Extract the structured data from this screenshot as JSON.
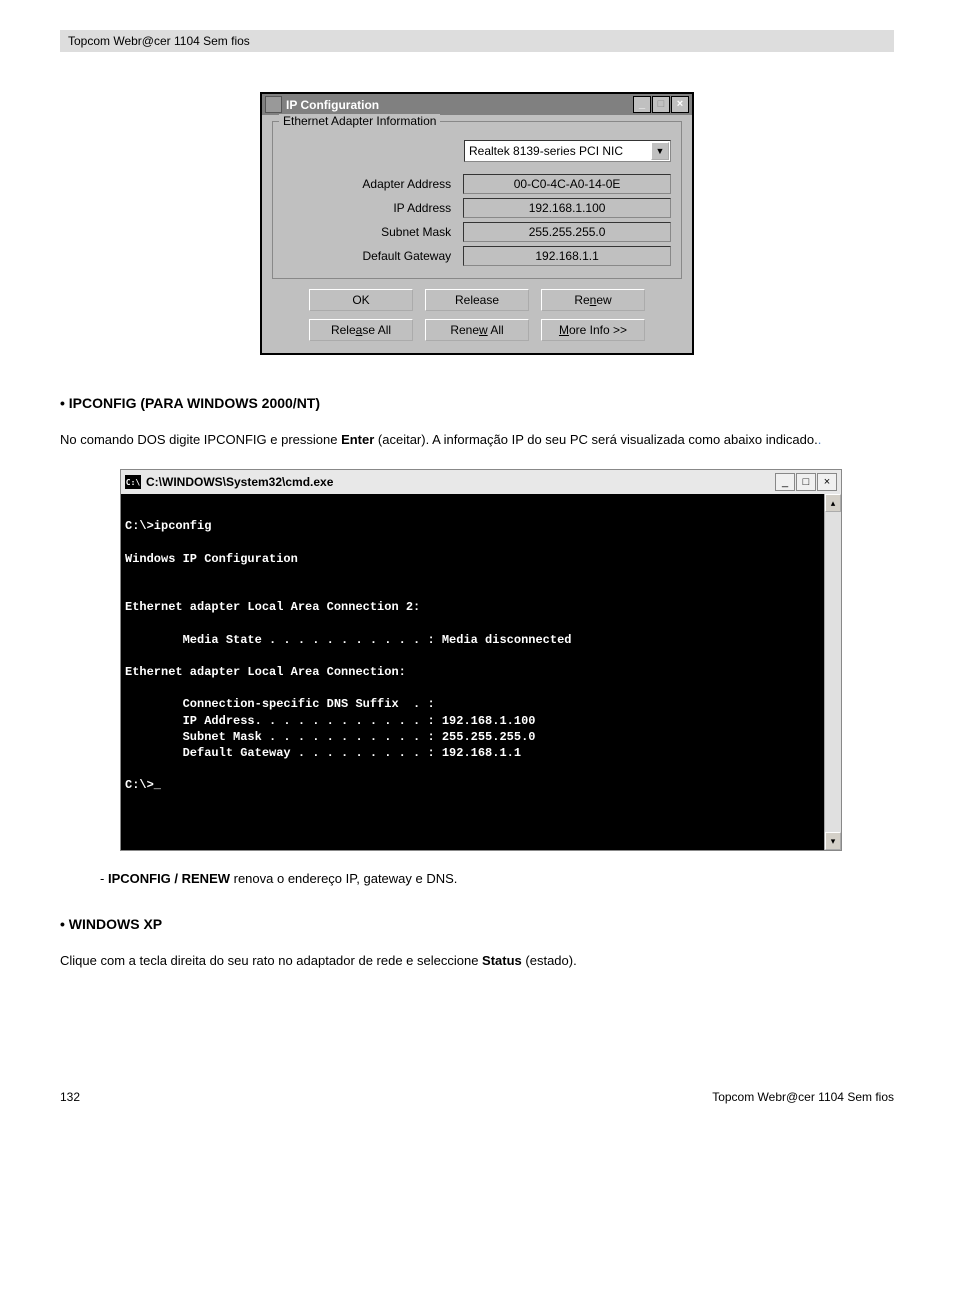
{
  "header": "Topcom  Webr@cer 1104 Sem fios",
  "ipcfg": {
    "title": "IP Configuration",
    "legend": "Ethernet Adapter Information",
    "adapter": "Realtek 8139-series PCI NIC",
    "rows": [
      {
        "label": "Adapter Address",
        "value": "00-C0-4C-A0-14-0E"
      },
      {
        "label": "IP Address",
        "value": "192.168.1.100"
      },
      {
        "label": "Subnet Mask",
        "value": "255.255.255.0"
      },
      {
        "label": "Default Gateway",
        "value": "192.168.1.1"
      }
    ],
    "buttons_row1": {
      "ok": "OK",
      "release": "Release",
      "renew": "Renew"
    },
    "buttons_row2": {
      "release_all": "Release All",
      "renew_all": "Renew All",
      "more_info": "More Info >>"
    }
  },
  "section1": {
    "heading": "• IPCONFIG (PARA WINDOWS 2000/NT)",
    "text_pre": "No comando DOS digite IPCONFIG e pressione ",
    "text_bold": "Enter",
    "text_post": " (aceitar). A informação IP do seu PC será visualizada como abaixo indicado.",
    "dots": "."
  },
  "cmd": {
    "title": "C:\\WINDOWS\\System32\\cmd.exe",
    "icon_text": "C:\\",
    "body": "\nC:\\>ipconfig\n\nWindows IP Configuration\n\n\nEthernet adapter Local Area Connection 2:\n\n        Media State . . . . . . . . . . . : Media disconnected\n\nEthernet adapter Local Area Connection:\n\n        Connection-specific DNS Suffix  . :\n        IP Address. . . . . . . . . . . . : 192.168.1.100\n        Subnet Mask . . . . . . . . . . . : 255.255.255.0\n        Default Gateway . . . . . . . . . : 192.168.1.1\n\nC:\\>_\n\n\n\n"
  },
  "renew_line": {
    "prefix": "- ",
    "bold": "IPCONFIG / RENEW",
    "rest": " renova o endereço IP, gateway e DNS."
  },
  "section2": {
    "heading": "• WINDOWS XP",
    "text_pre": "Clique com a tecla direita do seu rato no adaptador de rede e seleccione ",
    "text_bold": "Status",
    "text_post": " (estado)."
  },
  "footer": {
    "page": "132",
    "right": "Topcom  Webr@cer 1104 Sem fios"
  }
}
